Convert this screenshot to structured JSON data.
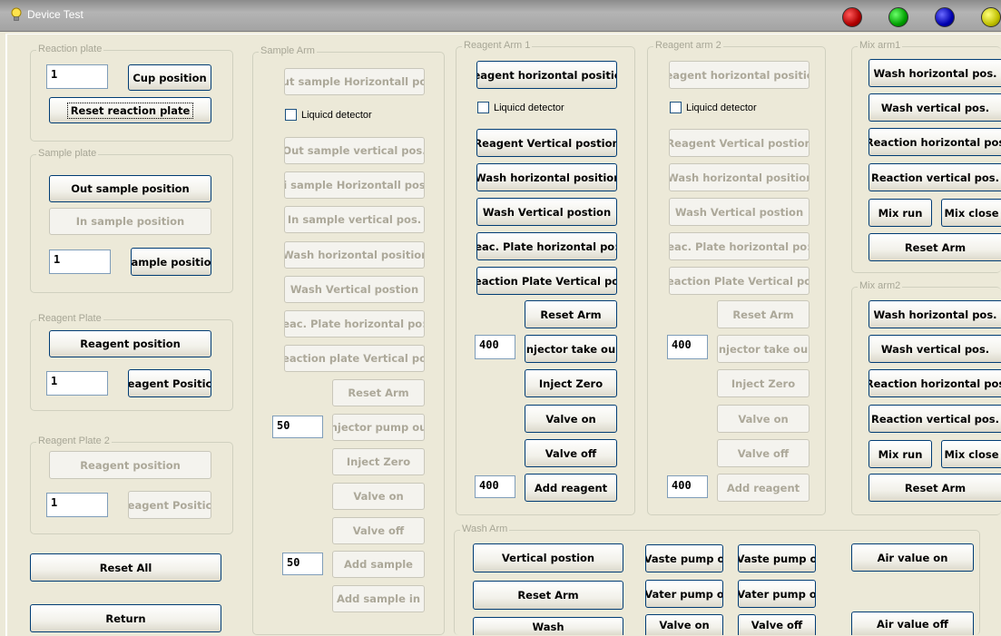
{
  "window": {
    "title": "Device Test"
  },
  "status_leds": [
    {
      "color": "#cc0000"
    },
    {
      "color": "#00aa00"
    },
    {
      "color": "#0000cc"
    },
    {
      "color": "#cccc00"
    }
  ],
  "reaction_plate": {
    "legend": "Reaction plate",
    "value": "1",
    "cup_position": "Cup position",
    "reset": "Reset reaction plate"
  },
  "sample_plate": {
    "legend": "Sample plate",
    "out_sample": "Out sample position",
    "in_sample": "In sample position",
    "value": "1",
    "sample_position": "ample positio"
  },
  "reagent_plate": {
    "legend": "Reagent Plate",
    "reagent_position": "Reagent position",
    "value": "1",
    "reagent_pos_btn": "eagent Positic"
  },
  "reagent_plate2": {
    "legend": "Reagent Plate 2",
    "reagent_position": "Reagent position",
    "value": "1",
    "reagent_pos_btn": "eagent Positic"
  },
  "reset_all": "Reset All",
  "return": "Return",
  "sample_arm": {
    "legend": "Sample Arm",
    "btn_out_horizontal": "ut sample Horizontall po",
    "liquid_detector": "Liquicd detector",
    "btn_out_vertical": "Out sample vertical pos.",
    "btn_in_horizontal": "i sample Horizontall pos",
    "btn_in_vertical": "In sample vertical pos.",
    "btn_wash_horizontal": "Wash horizontal positior",
    "btn_wash_vertical": "Wash Vertical postion",
    "btn_reac_horizontal": "eac. Plate horizontal po:",
    "btn_reac_vertical": "eaction plate Vertical po",
    "reset_arm": "Reset Arm",
    "inj_value": "50",
    "injector": "njector pump ou",
    "inject_zero": "Inject Zero",
    "valve_on": "Valve  on",
    "valve_off": "Valve off",
    "add_value": "50",
    "add_sample": "Add sample",
    "add_sample_in": "Add sample in"
  },
  "reagent_arm1": {
    "legend": "Reagent Arm 1",
    "btn_horizontal": "eagent horizontal positic",
    "liquid_detector": "Liquicd detector",
    "btn_vertical": "Reagent Vertical postion",
    "btn_wash_horizontal": "Wash horizontal positior",
    "btn_wash_vertical": "Wash Vertical postion",
    "btn_reac_horizontal": "eac. Plate horizontal po:",
    "btn_reac_vertical": "eaction Plate Vertical po",
    "reset_arm": "Reset Arm",
    "inj_value": "400",
    "injector": "njector take ou",
    "inject_zero": "Inject Zero",
    "valve_on": "Valve  on",
    "valve_off": "Valve off",
    "add_value": "400",
    "add_reagent": "Add reagent"
  },
  "reagent_arm2": {
    "legend": "Reagent arm 2",
    "btn_horizontal": "eagent horizontal positic",
    "liquid_detector": "Liquicd detector",
    "btn_vertical": "Reagent Vertical postion",
    "btn_wash_horizontal": "Wash horizontal positior",
    "btn_wash_vertical": "Wash Vertical postion",
    "btn_reac_horizontal": "eac. Plate horizontal po:",
    "btn_reac_vertical": "eaction Plate Vertical po",
    "reset_arm": "Reset Arm",
    "inj_value": "400",
    "injector": "njector take ou",
    "inject_zero": "Inject Zero",
    "valve_on": "Valve  on",
    "valve_off": "Valve off",
    "add_value": "400",
    "add_reagent": "Add reagent"
  },
  "mix_arm1": {
    "legend": "Mix arm1",
    "wash_horizontal": "Wash horizontal pos.",
    "wash_vertical": "Wash vertical pos.",
    "reaction_horizontal": "Reaction horizontal pos",
    "reaction_vertical": "Reaction vertical pos.",
    "mix_run": "Mix run",
    "mix_close": "Mix close",
    "reset_arm": "Reset  Arm"
  },
  "mix_arm2": {
    "legend": "Mix arm2",
    "wash_horizontal": "Wash horizontal pos.",
    "wash_vertical": "Wash vertical pos.",
    "reaction_horizontal": "Reaction horizontal pos",
    "reaction_vertical": "Reaction vertical pos.",
    "mix_run": "Mix run",
    "mix_close": "Mix close",
    "reset_arm": "Reset  Arm"
  },
  "wash_arm": {
    "legend": "Wash Arm",
    "vertical_position": "Vertical postion",
    "reset_arm": "Reset Arm",
    "wash": "Wash",
    "waste_pump_1": "Vaste pump o",
    "waste_pump_2": "Vaste pump o",
    "water_pump_1": "Vater pump o",
    "water_pump_2": "Vater pump o",
    "valve_on": "Valve on",
    "valve_off": "Valve off",
    "air_value_on": "Air value on",
    "air_value_off": "Air value off"
  }
}
